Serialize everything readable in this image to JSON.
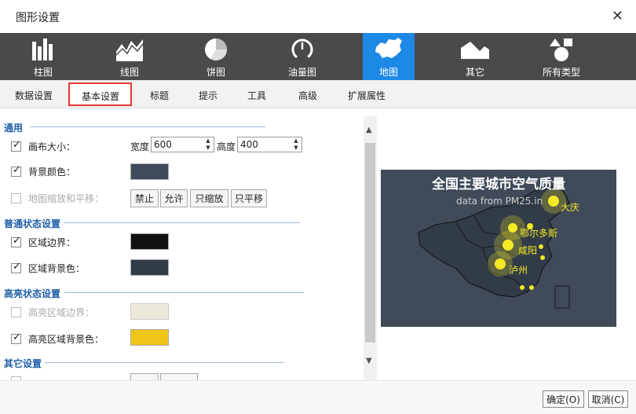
{
  "window": {
    "title": "图形设置",
    "close_glyph": "✕"
  },
  "chart_types": [
    {
      "label": "柱图",
      "icon": "bar-chart-icon"
    },
    {
      "label": "线图",
      "icon": "line-chart-icon"
    },
    {
      "label": "饼图",
      "icon": "pie-chart-icon"
    },
    {
      "label": "油量图",
      "icon": "gauge-icon"
    },
    {
      "label": "地图",
      "icon": "map-icon",
      "active": true
    },
    {
      "label": "其它",
      "icon": "area-icon"
    },
    {
      "label": "所有类型",
      "icon": "shapes-icon"
    }
  ],
  "tabs": [
    "数据设置",
    "基本设置",
    "标题",
    "提示",
    "工具",
    "高级",
    "扩展属性"
  ],
  "selected_tab": "基本设置",
  "sections": {
    "general": "通用",
    "normal": "普通状态设置",
    "highlight": "高亮状态设置",
    "other": "其它设置"
  },
  "general": {
    "canvas_size_label": "画布大小：",
    "width_label": "宽度",
    "width_value": "600",
    "height_label": "高度",
    "height_value": "400",
    "bg_color_label": "背景颜色：",
    "bg_color": "#404a59",
    "zoom_pan_label": "地图缩放和平移：",
    "zoom_buttons": [
      "禁止",
      "允许",
      "只缩放",
      "只平移"
    ]
  },
  "normal": {
    "border_label": "区域边界：",
    "border_color": "#111111",
    "bg_label": "区域背景色：",
    "bg_color": "#323c48"
  },
  "highlight": {
    "border_label": "高亮区域边界：",
    "border_color": "#ece9da",
    "bg_label": "高亮区域背景色：",
    "bg_color": "#f0c419"
  },
  "preview": {
    "title": "全国主要城市空气质量",
    "subtitle": "data from PM25.in",
    "cities": [
      "大庆",
      "鄂尔多斯",
      "咸阳",
      "泸州"
    ]
  },
  "footer": {
    "ok": "确定(O)",
    "cancel": "取消(C)"
  },
  "colors": {
    "toolbar_bg": "#4a4a4a",
    "accent": "#1e88e5",
    "section": "#1f5fa8",
    "tab_highlight": "#e53935"
  }
}
